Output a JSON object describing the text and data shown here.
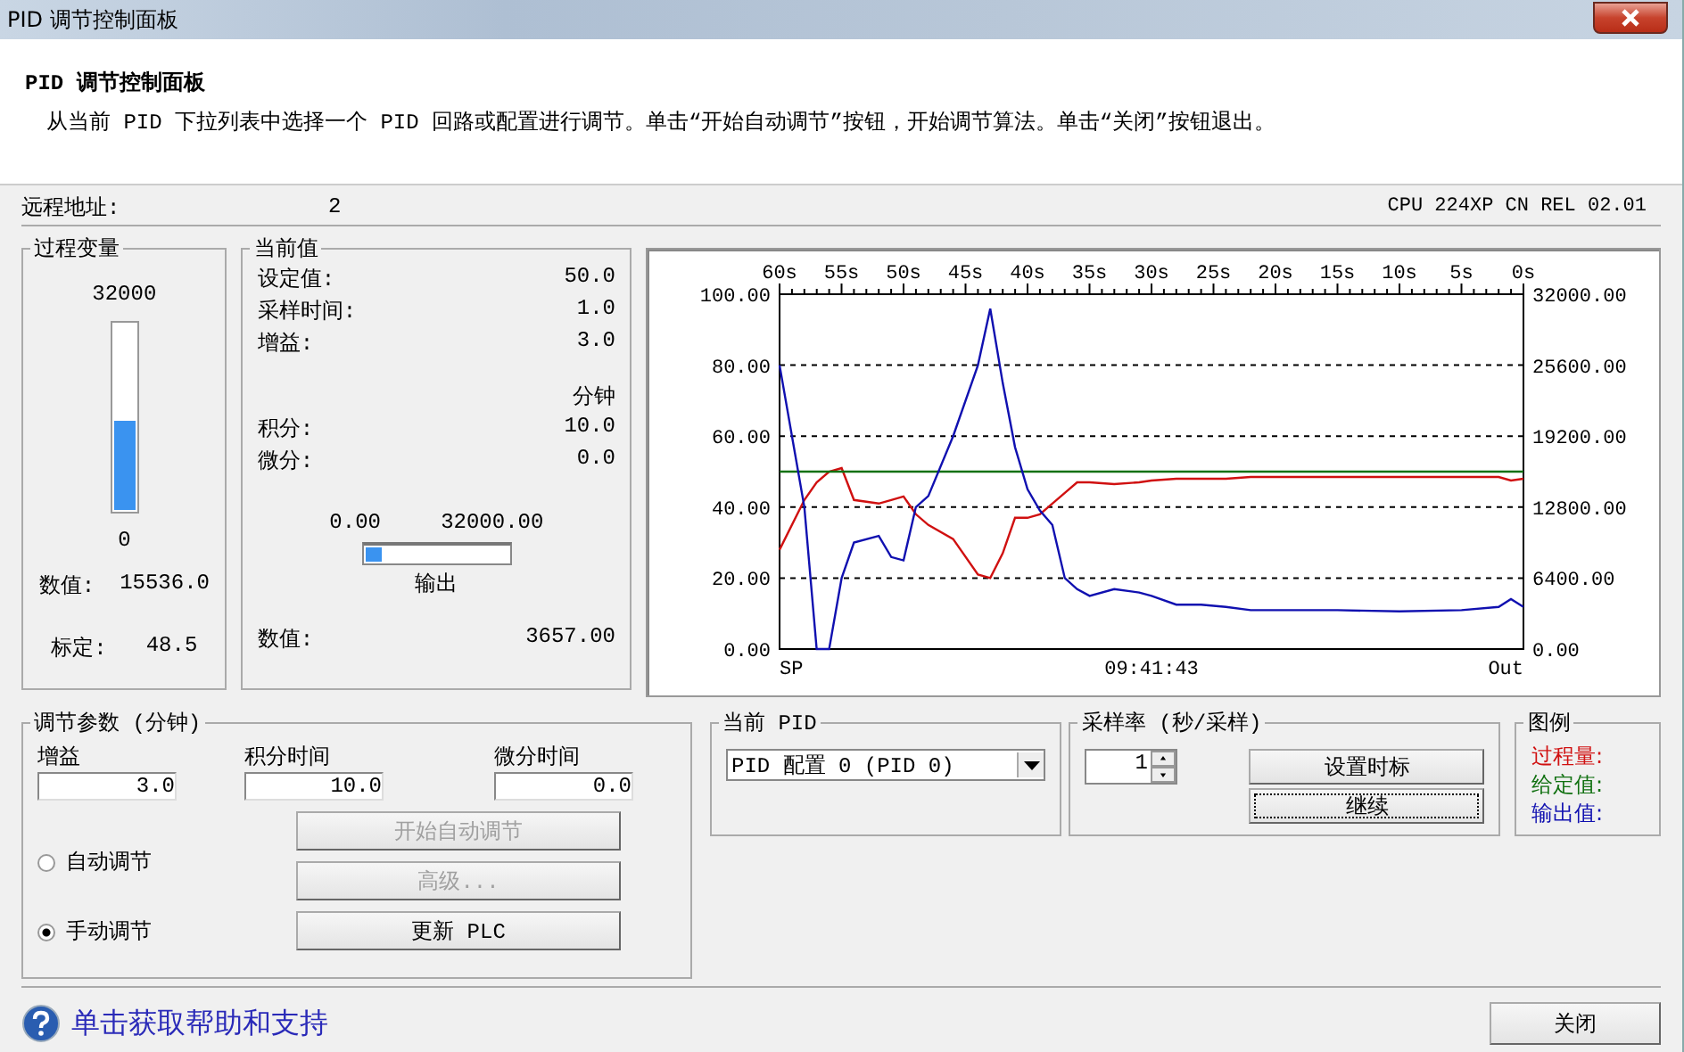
{
  "window": {
    "title": "PID 调节控制面板"
  },
  "header": {
    "title": "PID 调节控制面板",
    "description": "从当前 PID 下拉列表中选择一个 PID 回路或配置进行调节。单击“开始自动调节”按钮，开始调节算法。单击“关闭”按钮退出。"
  },
  "remote": {
    "label": "远程地址:",
    "value": "2",
    "cpu": "CPU 224XP CN REL 02.01"
  },
  "process_variable": {
    "legend": "过程变量",
    "max_label": "32000",
    "min_label": "0",
    "level": 0.4855,
    "value_label": "数值:",
    "value": "15536.0",
    "scale_label": "标定:",
    "scale": "48.5"
  },
  "current_values": {
    "legend": "当前值",
    "rows": [
      {
        "label": "设定值:",
        "value": "50.0"
      },
      {
        "label": "采样时间:",
        "value": "1.0"
      },
      {
        "label": "增益:",
        "value": "3.0"
      }
    ],
    "unit": "分钟",
    "rows2": [
      {
        "label": "积分:",
        "value": "10.0"
      },
      {
        "label": "微分:",
        "value": "0.0"
      }
    ],
    "output": {
      "min": "0.00",
      "max": "32000.00",
      "level": 0.114,
      "caption": "输出"
    },
    "value_label": "数值:",
    "value": "3657.00"
  },
  "chart": {
    "chart_data": {
      "type": "line",
      "x": [
        60,
        58,
        57,
        56,
        55,
        54,
        52,
        51,
        50,
        49,
        48,
        46,
        44,
        43,
        42,
        41,
        40,
        39,
        38,
        37,
        36,
        35,
        33,
        31,
        30,
        28,
        26,
        24,
        22,
        20,
        15,
        10,
        5,
        2,
        1,
        0
      ],
      "xlim": [
        60,
        0
      ],
      "ylim": [
        0,
        100
      ],
      "y2lim": [
        0,
        32000
      ],
      "grid": true,
      "xticks": [
        {
          "value": 60,
          "label": "60s"
        },
        {
          "value": 55,
          "label": "55s"
        },
        {
          "value": 50,
          "label": "50s"
        },
        {
          "value": 45,
          "label": "45s"
        },
        {
          "value": 40,
          "label": "40s"
        },
        {
          "value": 35,
          "label": "35s"
        },
        {
          "value": 30,
          "label": "30s"
        },
        {
          "value": 25,
          "label": "25s"
        },
        {
          "value": 20,
          "label": "20s"
        },
        {
          "value": 15,
          "label": "15s"
        },
        {
          "value": 10,
          "label": "10s"
        },
        {
          "value": 5,
          "label": "5s"
        },
        {
          "value": 0,
          "label": "0s"
        }
      ],
      "yticks": [
        {
          "value": 0,
          "label": "0.00"
        },
        {
          "value": 20,
          "label": "20.00"
        },
        {
          "value": 40,
          "label": "40.00"
        },
        {
          "value": 60,
          "label": "60.00"
        },
        {
          "value": 80,
          "label": "80.00"
        },
        {
          "value": 100,
          "label": "100.00"
        }
      ],
      "y2ticks": [
        {
          "value": 0,
          "label": "0.00"
        },
        {
          "value": 6400,
          "label": "6400.00"
        },
        {
          "value": 12800,
          "label": "12800.00"
        },
        {
          "value": 19200,
          "label": "19200.00"
        },
        {
          "value": 25600,
          "label": "25600.00"
        },
        {
          "value": 32000,
          "label": "32000.00"
        }
      ],
      "series": [
        {
          "color": "#d01010",
          "values": [
            28,
            42,
            47,
            50,
            51,
            42,
            41,
            42,
            43,
            38,
            35,
            31,
            21,
            20,
            27,
            37,
            37,
            38,
            41,
            44,
            47,
            47,
            46.5,
            47,
            47.5,
            48,
            48,
            48,
            48.5,
            48.5,
            48.5,
            48.5,
            48.5,
            48.5,
            47.5,
            48
          ]
        },
        {
          "color": "#107010",
          "values": [
            50,
            50,
            50,
            50,
            50,
            50,
            50,
            50,
            50,
            50,
            50,
            50,
            50,
            50,
            50,
            50,
            50,
            50,
            50,
            50,
            50,
            50,
            50,
            50,
            50,
            50,
            50,
            50,
            50,
            50,
            50,
            50,
            50,
            50,
            50,
            50
          ]
        },
        {
          "color": "#1010b0",
          "axis": "y2",
          "values": [
            25600,
            12800,
            0,
            0,
            6400,
            9600,
            10200,
            8300,
            8000,
            12800,
            13800,
            19200,
            25600,
            30700,
            24000,
            18200,
            14400,
            12500,
            11200,
            6400,
            5400,
            4800,
            5400,
            5100,
            4800,
            4000,
            4000,
            3800,
            3500,
            3500,
            3500,
            3400,
            3500,
            3800,
            4500,
            3800
          ]
        }
      ]
    },
    "left_label": "SP",
    "time": "09:41:43",
    "right_label": "Out"
  },
  "tuning": {
    "legend": "调节参数 (分钟)",
    "fields": [
      {
        "label": "增益",
        "value": "3.0"
      },
      {
        "label": "积分时间",
        "value": "10.0"
      },
      {
        "label": "微分时间",
        "value": "0.0"
      }
    ],
    "modes": [
      {
        "label": "自动调节",
        "selected": false
      },
      {
        "label": "手动调节",
        "selected": true
      }
    ],
    "buttons": [
      {
        "label": "开始自动调节",
        "disabled": true
      },
      {
        "label": "高级...",
        "disabled": true
      },
      {
        "label": "更新 PLC",
        "disabled": false
      }
    ]
  },
  "pid": {
    "legend": "当前 PID",
    "selected": "PID 配置 0 (PID 0)"
  },
  "sample_rate": {
    "legend": "采样率 (秒/采样)",
    "value": "1",
    "buttons": [
      {
        "label": "设置时标",
        "focused": false
      },
      {
        "label": "继续",
        "focused": true
      }
    ]
  },
  "legend_box": {
    "legend": "图例",
    "items": [
      {
        "label": "过程量:",
        "color": "#d01010"
      },
      {
        "label": "给定值:",
        "color": "#107010"
      },
      {
        "label": "输出值:",
        "color": "#1010b0"
      }
    ]
  },
  "help": {
    "text": "单击获取帮助和支持"
  },
  "close_button": {
    "label": "关闭"
  }
}
